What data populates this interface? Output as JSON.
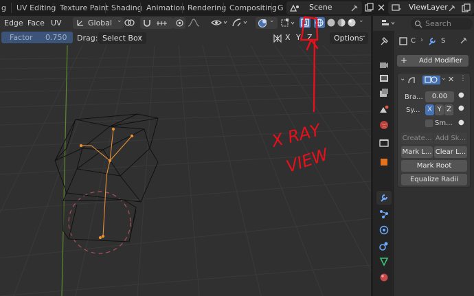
{
  "topbar": {
    "tabs": [
      "g",
      "UV Editing",
      "Texture Paint",
      "Shading",
      "Animation",
      "Rendering",
      "Compositing",
      "G"
    ],
    "scene_name": "Scene",
    "view_layer": "ViewLayer"
  },
  "header": {
    "menus": [
      "Edge",
      "Face",
      "UV"
    ],
    "orientation": "Global"
  },
  "operator": {
    "factor_label": "Factor",
    "factor_value": "0.750",
    "drag_label": "Drag:",
    "drag_value": "Select Box",
    "axis_x": "X",
    "axis_y": "Y",
    "axis_z": "Z",
    "options_label": "Options"
  },
  "properties": {
    "search_placeholder": "Search",
    "breadcrumb_a": "C",
    "breadcrumb_b": "S",
    "add_modifier": "Add Modifier",
    "branch_label": "Bra...",
    "branch_value": "0.00",
    "symmetry_label": "Sy...",
    "sym_x": "X",
    "sym_y": "Y",
    "sym_z": "Z",
    "smooth_label": "Sm...",
    "create_label": "Create...",
    "add_skin_label": "Add Sk...",
    "mark_loose_label": "Mark L...",
    "clear_loose_label": "Clear L...",
    "mark_root_label": "Mark Root",
    "equalize_label": "Equalize Radii"
  },
  "annotation": {
    "line1": "X RAY",
    "line2": "VIEW",
    "color": "#e8101a"
  },
  "colors": {
    "accent": "#4772b3",
    "background": "#303030",
    "topbar": "#1d1d1d"
  }
}
